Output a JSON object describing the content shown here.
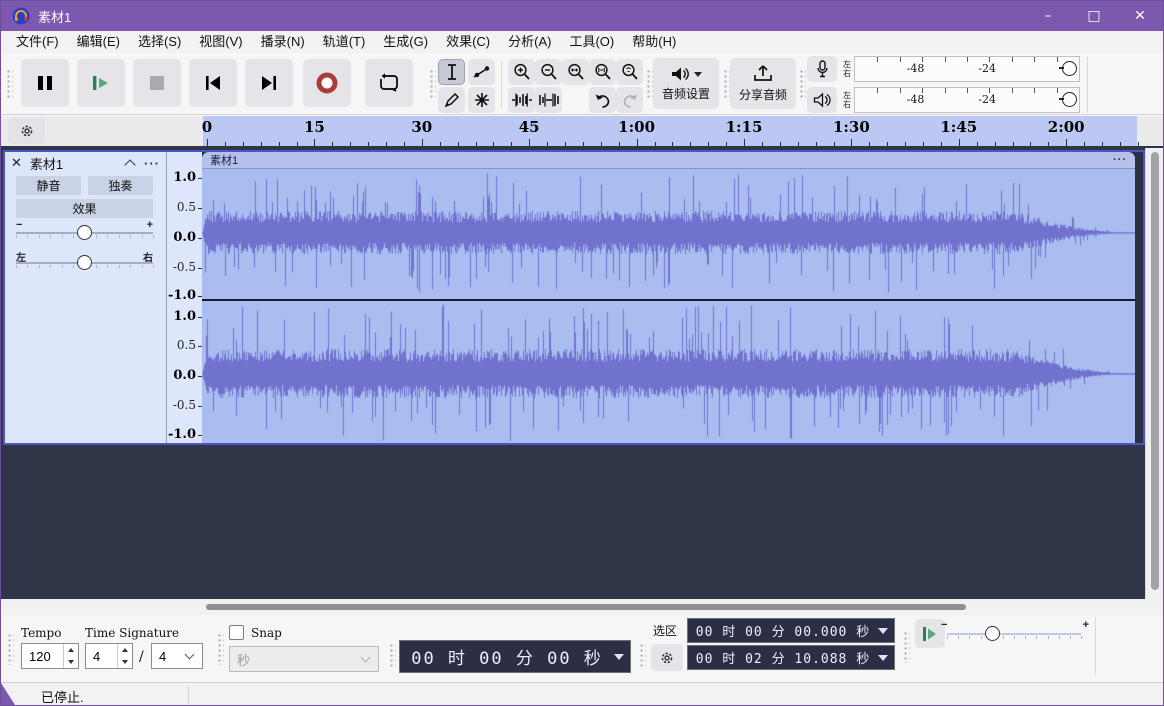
{
  "window": {
    "title": "素材1",
    "minimize": "–",
    "maximize": "□",
    "close": "✕"
  },
  "menu": {
    "items": [
      "文件(F)",
      "编辑(E)",
      "选择(S)",
      "视图(V)",
      "播录(N)",
      "轨道(T)",
      "生成(G)",
      "效果(C)",
      "分析(A)",
      "工具(O)",
      "帮助(H)"
    ]
  },
  "toolbar": {
    "audio_setup_label": "音频设置",
    "share_label": "分享音频"
  },
  "meters": {
    "record": {
      "left": "左",
      "right": "右"
    },
    "play": {
      "left": "左",
      "right": "右"
    },
    "scale_labels": [
      "-48",
      "-24"
    ]
  },
  "timeline": {
    "ticks": [
      "0",
      "15",
      "30",
      "45",
      "1:00",
      "1:15",
      "1:30",
      "1:45",
      "2:00"
    ]
  },
  "track": {
    "name": "素材1",
    "close": "✕",
    "menu": "···",
    "mute": "静音",
    "solo": "独奏",
    "effects": "效果",
    "gain_minus": "−",
    "gain_plus": "+",
    "pan_left": "左",
    "pan_right": "右",
    "scale_labels": [
      "1.0",
      "0.5",
      "0.0",
      "-0.5",
      "-1.0"
    ],
    "clip": {
      "name": "素材1",
      "menu": "···"
    }
  },
  "bottom": {
    "tempo_label": "Tempo",
    "tempo_value": "120",
    "time_sig_label": "Time Signature",
    "time_sig_upper": "4",
    "time_sig_slash": "/",
    "time_sig_lower": "4",
    "snap_label": "Snap",
    "snap_unit": "秒",
    "time_display": "00 时 00 分 00 秒",
    "selection_label": "选区",
    "sel_start": "00 时 00 分 00.000 秒",
    "sel_end": "00 时 02 分 10.088 秒"
  },
  "status": {
    "text": "已停止."
  }
}
